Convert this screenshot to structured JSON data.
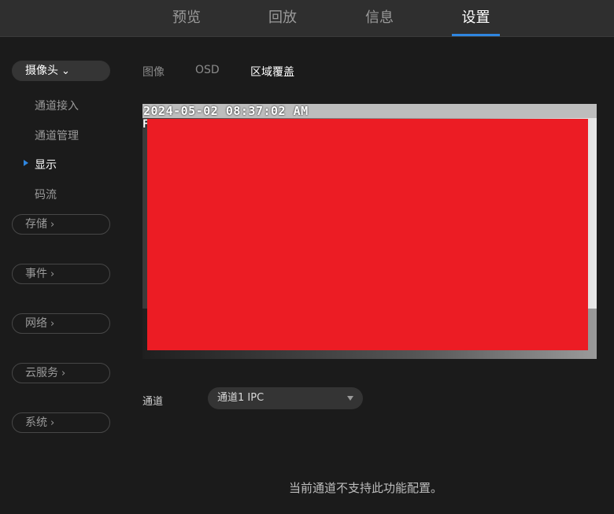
{
  "top_nav": {
    "tabs": [
      {
        "label": "预览"
      },
      {
        "label": "回放"
      },
      {
        "label": "信息"
      },
      {
        "label": "设置"
      }
    ],
    "active_index": 3
  },
  "sidebar": {
    "camera": {
      "label": "摄像头",
      "chevron": "chevron-down-icon"
    },
    "camera_items": [
      {
        "label": "通道接入"
      },
      {
        "label": "通道管理"
      },
      {
        "label": "显示"
      },
      {
        "label": "码流"
      }
    ],
    "active_item_index": 2,
    "groups": [
      {
        "label": "存储",
        "chevron": "chevron-right-icon"
      },
      {
        "label": "事件",
        "chevron": "chevron-right-icon"
      },
      {
        "label": "网络",
        "chevron": "chevron-right-icon"
      },
      {
        "label": "云服务",
        "chevron": "chevron-right-icon"
      },
      {
        "label": "系统",
        "chevron": "chevron-right-icon"
      }
    ]
  },
  "sub_tabs": {
    "tabs": [
      {
        "label": "图像"
      },
      {
        "label": "OSD"
      },
      {
        "label": "区域覆盖"
      }
    ],
    "active_index": 2
  },
  "video": {
    "timestamp": "2024-05-02 08:37:02 AM",
    "osd_fragment": "F",
    "mask_color": "#ec1c24"
  },
  "channel": {
    "label": "通道",
    "selected": "通道1 IPC"
  },
  "notice": "当前通道不支持此功能配置。",
  "colors": {
    "accent": "#2f86e0",
    "background": "#1b1b1b",
    "topbar": "#2f2f2f"
  }
}
